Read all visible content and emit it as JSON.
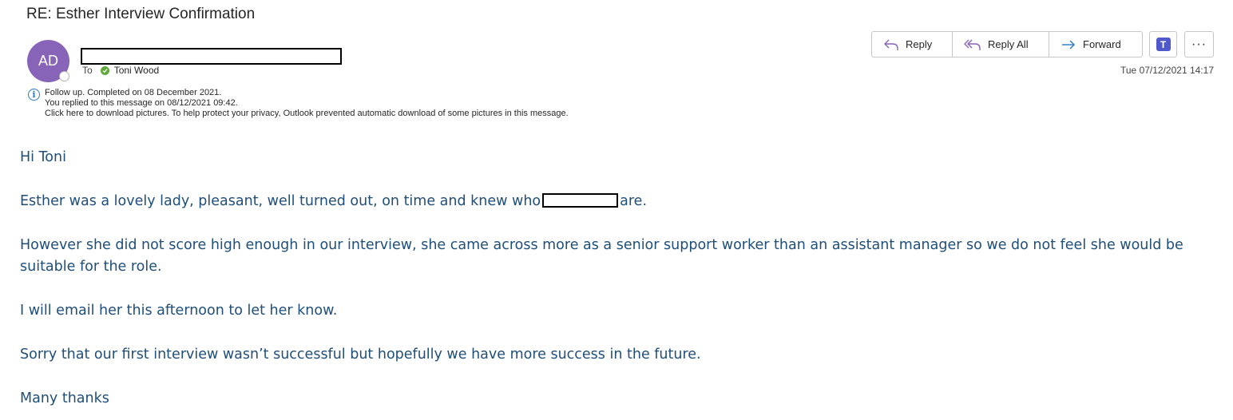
{
  "subject": "RE: Esther Interview Confirmation",
  "sender": {
    "initials": "AD",
    "avatar_color": "#8764b8"
  },
  "to_label": "To",
  "recipient": "Toni Wood",
  "info": {
    "line1": "Follow up.  Completed on 08 December 2021.",
    "line2": "You replied to this message on 08/12/2021 09:42.",
    "line3": "Click here to download pictures. To help protect your privacy, Outlook prevented automatic download of some pictures in this message."
  },
  "actions": {
    "reply": "Reply",
    "reply_all": "Reply All",
    "forward": "Forward",
    "more": "···"
  },
  "date": "Tue 07/12/2021 14:17",
  "body": {
    "greeting": "Hi Toni",
    "p1_before": "Esther was a lovely lady, pleasant, well turned out, on time and knew who",
    "p1_after": "are.",
    "p2": "However she did not score high enough in our interview, she came across more as a senior support worker than an assistant manager so we do not feel she would be suitable for the role.",
    "p3": "I will email her this afternoon to let her know.",
    "p4": "Sorry that our first interview wasn’t successful but hopefully we have more success in the future.",
    "closing": "Many thanks"
  },
  "colors": {
    "body_text": "#1f4e79",
    "accent": "#2b79c2",
    "teams": "#5059c9"
  }
}
